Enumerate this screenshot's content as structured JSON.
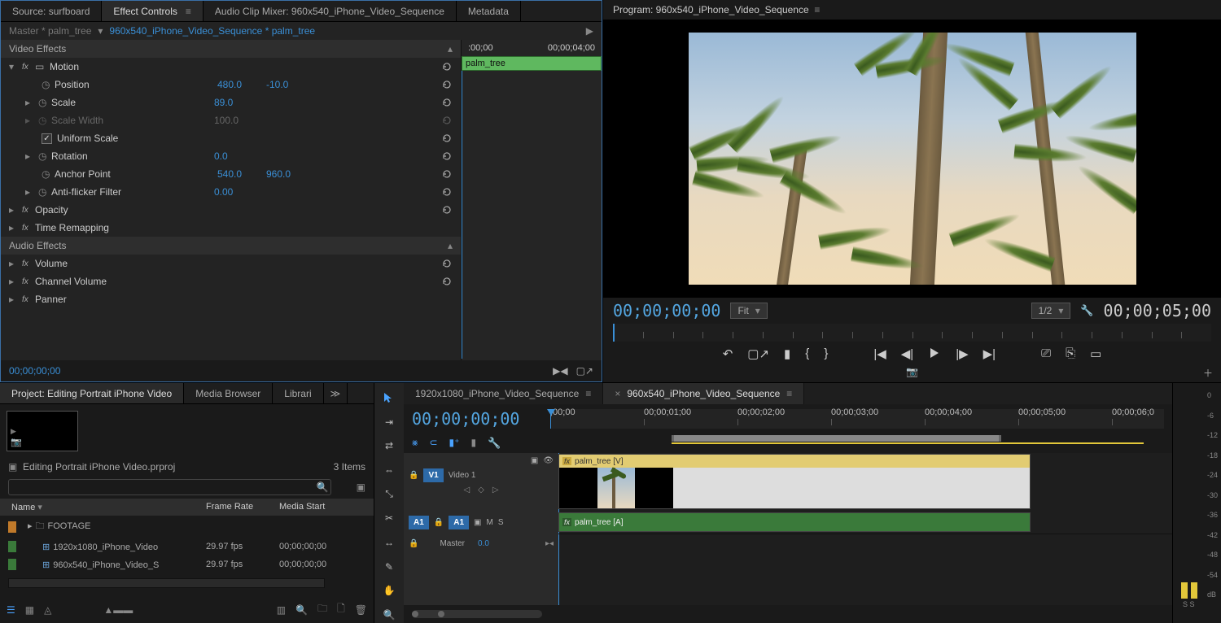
{
  "sourceTabs": {
    "source": "Source: surfboard",
    "effectControls": "Effect Controls",
    "audioClipMixer": "Audio Clip Mixer: 960x540_iPhone_Video_Sequence",
    "metadata": "Metadata"
  },
  "effectControls": {
    "master": "Master * palm_tree",
    "clipPath": "960x540_iPhone_Video_Sequence * palm_tree",
    "timeStart": ":00;00",
    "timeEnd": "00;00;04;00",
    "clipLabel": "palm_tree",
    "videoEffectsHdr": "Video Effects",
    "audioEffectsHdr": "Audio Effects",
    "motion": {
      "label": "Motion",
      "position": {
        "label": "Position",
        "x": "480.0",
        "y": "-10.0"
      },
      "scale": {
        "label": "Scale",
        "val": "89.0"
      },
      "scaleWidth": {
        "label": "Scale Width",
        "val": "100.0"
      },
      "uniform": "Uniform Scale",
      "rotation": {
        "label": "Rotation",
        "val": "0.0"
      },
      "anchor": {
        "label": "Anchor Point",
        "x": "540.0",
        "y": "960.0"
      },
      "antiflicker": {
        "label": "Anti-flicker Filter",
        "val": "0.00"
      }
    },
    "opacity": "Opacity",
    "timeRemap": "Time Remapping",
    "volume": "Volume",
    "channelVolume": "Channel Volume",
    "panner": "Panner",
    "timecodeFoot": "00;00;00;00"
  },
  "program": {
    "title": "Program: 960x540_iPhone_Video_Sequence",
    "tcLeft": "00;00;00;00",
    "fit": "Fit",
    "res": "1/2",
    "tcRight": "00;00;05;00"
  },
  "project": {
    "tabProject": "Project: Editing Portrait iPhone Video",
    "tabMediaBrowser": "Media Browser",
    "tabLibraries": "Librari",
    "fileName": "Editing Portrait iPhone Video.prproj",
    "itemCount": "3 Items",
    "searchPlaceholder": "",
    "colName": "Name",
    "colFrameRate": "Frame Rate",
    "colMediaStart": "Media Start",
    "rows": [
      {
        "swatch": "sw-orange",
        "icon": "folder",
        "name": "FOOTAGE",
        "fps": "",
        "ms": ""
      },
      {
        "swatch": "sw-green",
        "icon": "seq",
        "name": "1920x1080_iPhone_Video",
        "fps": "29.97 fps",
        "ms": "00;00;00;00"
      },
      {
        "swatch": "sw-green",
        "icon": "seq",
        "name": "960x540_iPhone_Video_S",
        "fps": "29.97 fps",
        "ms": "00;00;00;00"
      }
    ]
  },
  "timeline": {
    "tab1": "1920x1080_iPhone_Video_Sequence",
    "tab2": "960x540_iPhone_Video_Sequence",
    "tc": "00;00;00;00",
    "ruler": [
      ";00;00",
      "00;00;01;00",
      "00;00;02;00",
      "00;00;03;00",
      "00;00;04;00",
      "00;00;05;00",
      "00;00;06;0"
    ],
    "trackV1": "V1",
    "trackV1Name": "Video 1",
    "trackA1": "A1",
    "trackMaster": "Master",
    "masterVal": "0.0",
    "videoClip": "palm_tree [V]",
    "audioClip": "palm_tree [A]",
    "mute": "M",
    "solo": "S"
  },
  "meters": {
    "scale": [
      "0",
      "-6",
      "-12",
      "-18",
      "-24",
      "-30",
      "-36",
      "-42",
      "-48",
      "-54",
      "dB"
    ],
    "solo": "S  S"
  }
}
